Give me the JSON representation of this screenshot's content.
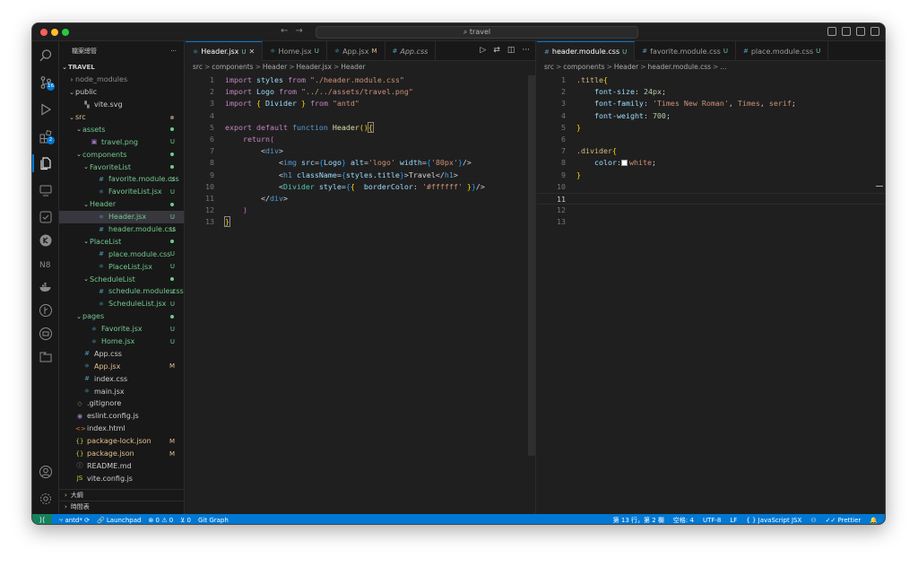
{
  "titlebar": {
    "search_text": "travel"
  },
  "activitybar": {
    "scm_badge": "16",
    "extensions_badge": "2"
  },
  "sidebar": {
    "title": "檔案總管",
    "more": "···",
    "root": "TRAVEL",
    "items": [
      {
        "label": "node_modules",
        "indent": 1,
        "chev": "›",
        "icon": "",
        "status": "",
        "cls": "name-dim"
      },
      {
        "label": "public",
        "indent": 1,
        "chev": "⌄",
        "icon": "",
        "status": "",
        "cls": ""
      },
      {
        "label": "vite.svg",
        "indent": 2,
        "chev": "",
        "icon": "▚",
        "status": "",
        "cls": ""
      },
      {
        "label": "src",
        "indent": 1,
        "chev": "⌄",
        "icon": "",
        "status": "dot-m",
        "cls": "name-m"
      },
      {
        "label": "assets",
        "indent": 2,
        "chev": "⌄",
        "icon": "",
        "status": "dot",
        "cls": "name-u"
      },
      {
        "label": "travel.png",
        "indent": 3,
        "chev": "",
        "icon": "▣",
        "status": "U",
        "cls": "name-u"
      },
      {
        "label": "components",
        "indent": 2,
        "chev": "⌄",
        "icon": "",
        "status": "dot",
        "cls": "name-u"
      },
      {
        "label": "FavoriteList",
        "indent": 3,
        "chev": "⌄",
        "icon": "",
        "status": "dot",
        "cls": "name-u"
      },
      {
        "label": "favorite.module.css",
        "indent": 4,
        "chev": "",
        "icon": "#",
        "status": "U",
        "cls": "name-u"
      },
      {
        "label": "FavoriteList.jsx",
        "indent": 4,
        "chev": "",
        "icon": "⚛",
        "status": "U",
        "cls": "name-u"
      },
      {
        "label": "Header",
        "indent": 3,
        "chev": "⌄",
        "icon": "",
        "status": "dot",
        "cls": "name-u"
      },
      {
        "label": "Header.jsx",
        "indent": 4,
        "chev": "",
        "icon": "⚛",
        "status": "U",
        "cls": "name-u",
        "selected": true
      },
      {
        "label": "header.module.css",
        "indent": 4,
        "chev": "",
        "icon": "#",
        "status": "U",
        "cls": "name-u"
      },
      {
        "label": "PlaceList",
        "indent": 3,
        "chev": "⌄",
        "icon": "",
        "status": "dot",
        "cls": "name-u"
      },
      {
        "label": "place.module.css",
        "indent": 4,
        "chev": "",
        "icon": "#",
        "status": "U",
        "cls": "name-u"
      },
      {
        "label": "PlaceList.jsx",
        "indent": 4,
        "chev": "",
        "icon": "⚛",
        "status": "U",
        "cls": "name-u"
      },
      {
        "label": "ScheduleList",
        "indent": 3,
        "chev": "⌄",
        "icon": "",
        "status": "dot",
        "cls": "name-u"
      },
      {
        "label": "schedule.module.css",
        "indent": 4,
        "chev": "",
        "icon": "#",
        "status": "U",
        "cls": "name-u"
      },
      {
        "label": "ScheduleList.jsx",
        "indent": 4,
        "chev": "",
        "icon": "⚛",
        "status": "U",
        "cls": "name-u"
      },
      {
        "label": "pages",
        "indent": 2,
        "chev": "⌄",
        "icon": "",
        "status": "dot",
        "cls": "name-u"
      },
      {
        "label": "Favorite.jsx",
        "indent": 3,
        "chev": "",
        "icon": "⚛",
        "status": "U",
        "cls": "name-u"
      },
      {
        "label": "Home.jsx",
        "indent": 3,
        "chev": "",
        "icon": "⚛",
        "status": "U",
        "cls": "name-u"
      },
      {
        "label": "App.css",
        "indent": 2,
        "chev": "",
        "icon": "#",
        "status": "",
        "cls": ""
      },
      {
        "label": "App.jsx",
        "indent": 2,
        "chev": "",
        "icon": "⚛",
        "status": "M",
        "cls": "name-m"
      },
      {
        "label": "index.css",
        "indent": 2,
        "chev": "",
        "icon": "#",
        "status": "",
        "cls": ""
      },
      {
        "label": "main.jsx",
        "indent": 2,
        "chev": "",
        "icon": "⚛",
        "status": "",
        "cls": ""
      },
      {
        "label": ".gitignore",
        "indent": 1,
        "chev": "",
        "icon": "◇",
        "status": "",
        "cls": ""
      },
      {
        "label": "eslint.config.js",
        "indent": 1,
        "chev": "",
        "icon": "◉",
        "status": "",
        "cls": ""
      },
      {
        "label": "index.html",
        "indent": 1,
        "chev": "",
        "icon": "<>",
        "status": "",
        "cls": ""
      },
      {
        "label": "package-lock.json",
        "indent": 1,
        "chev": "",
        "icon": "{}",
        "status": "M",
        "cls": "name-m"
      },
      {
        "label": "package.json",
        "indent": 1,
        "chev": "",
        "icon": "{}",
        "status": "M",
        "cls": "name-m"
      },
      {
        "label": "README.md",
        "indent": 1,
        "chev": "",
        "icon": "ⓘ",
        "status": "",
        "cls": ""
      },
      {
        "label": "vite.config.js",
        "indent": 1,
        "chev": "",
        "icon": "JS",
        "status": "",
        "cls": ""
      }
    ],
    "outline": "大綱",
    "timeline": "時間表"
  },
  "left_editor": {
    "tabs": [
      {
        "icon": "⚛",
        "label": "Header.jsx",
        "status": "U",
        "active": true,
        "close": "✕"
      },
      {
        "icon": "⚛",
        "label": "Home.jsx",
        "status": "U",
        "active": false
      },
      {
        "icon": "⚛",
        "label": "App.jsx",
        "status": "M",
        "active": false
      },
      {
        "icon": "#",
        "label": "App.css",
        "status": "",
        "active": false,
        "italic": true
      }
    ],
    "breadcrumb": [
      "src",
      "components",
      "Header",
      "Header.jsx",
      "Header"
    ],
    "lines": [
      "<span class='kw'>import</span> <span class='var'>styles</span> <span class='kw'>from</span> <span class='str'>\"./header.module.css\"</span>",
      "<span class='kw'>import</span> <span class='var'>Logo</span> <span class='kw'>from</span> <span class='str'>\"../../assets/travel.png\"</span>",
      "<span class='kw'>import</span> <span class='br1'>{</span> <span class='var'>Divider</span> <span class='br1'>}</span> <span class='kw'>from</span> <span class='str'>\"antd\"</span>",
      "",
      "<span class='kw'>export</span> <span class='kw'>default</span> <span class='kw2'>function</span> <span class='fn'>Header</span><span class='br1'>()</span><span class='br1 cursor-box'>{</span>",
      "    <span class='kw'>return</span><span class='br2'>(</span>",
      "        <span class='pun'>&lt;</span><span class='tag'>div</span><span class='pun'>&gt;</span>",
      "            <span class='pun'>&lt;</span><span class='tag'>img</span> <span class='attr'>src</span><span class='pun'>=</span><span class='br3'>{</span><span class='var'>Logo</span><span class='br3'>}</span> <span class='attr'>alt</span><span class='pun'>=</span><span class='str'>'logo'</span> <span class='attr'>width</span><span class='pun'>=</span><span class='br3'>{</span><span class='str'>'80px'</span><span class='br3'>}</span><span class='pun'>/&gt;</span>",
      "            <span class='pun'>&lt;</span><span class='tag'>h1</span> <span class='attr'>className</span><span class='pun'>=</span><span class='br3'>{</span><span class='var'>styles</span><span class='pun'>.</span><span class='var'>title</span><span class='br3'>}</span><span class='pun'>&gt;</span><span class='pun'>Travel</span><span class='pun'>&lt;/</span><span class='tag'>h1</span><span class='pun'>&gt;</span>",
      "            <span class='pun'>&lt;</span><span class='cls'>Divider</span> <span class='attr'>style</span><span class='pun'>=</span><span class='br3'>{</span><span class='br1'>{</span>  <span class='prop'>borderColor</span><span class='pun'>:</span> <span class='str'>'#ffffff'</span> <span class='br1'>}</span><span class='br3'>}</span><span class='pun'>/&gt;</span>",
      "        <span class='pun'>&lt;/</span><span class='tag'>div</span><span class='pun'>&gt;</span>",
      "    <span class='br2'>)</span>",
      "<span class='br1 cursor-box'>}</span>"
    ],
    "line_numbers": [
      "1",
      "2",
      "3",
      "4",
      "5",
      "6",
      "7",
      "8",
      "9",
      "10",
      "11",
      "12",
      "13"
    ]
  },
  "right_editor": {
    "tabs": [
      {
        "icon": "#",
        "label": "header.module.css",
        "status": "U",
        "active": true
      },
      {
        "icon": "#",
        "label": "favorite.module.css",
        "status": "U",
        "active": false
      },
      {
        "icon": "#",
        "label": "place.module.css",
        "status": "U",
        "active": false
      }
    ],
    "breadcrumb": [
      "src",
      "components",
      "Header",
      "header.module.css",
      "..."
    ],
    "lines": [
      "<span class='sel'>.title</span><span class='br1'>{</span>",
      "    <span class='prop'>font-size</span><span class='pun'>:</span> <span class='num'>24px</span><span class='pun'>;</span>",
      "    <span class='prop'>font-family</span><span class='pun'>:</span> <span class='str'>'Times New Roman'</span><span class='pun'>,</span> <span class='str'>Times</span><span class='pun'>,</span> <span class='str'>serif</span><span class='pun'>;</span>",
      "    <span class='prop'>font-weight</span><span class='pun'>:</span> <span class='num'>700</span><span class='pun'>;</span>",
      "<span class='br1'>}</span>",
      "",
      "<span class='sel'>.divider</span><span class='br1'>{</span>",
      "    <span class='prop'>color</span><span class='pun'>:</span><span class='swatch'></span><span class='str'>white</span><span class='pun'>;</span>",
      "<span class='br1'>}</span>",
      "",
      "",
      "",
      ""
    ],
    "line_numbers": [
      "1",
      "2",
      "3",
      "4",
      "5",
      "6",
      "7",
      "8",
      "9",
      "10",
      "11",
      "12",
      "13"
    ]
  },
  "statusbar": {
    "branch": "antd*",
    "launchpad": "Launchpad",
    "problems": "⊗ 0 ⚠ 0",
    "ports": "0",
    "gitgraph": "Git Graph",
    "position": "第 13 行，第 2 欄",
    "spaces": "空格: 4",
    "encoding": "UTF-8",
    "eol": "LF",
    "language": "JavaScript JSX",
    "formatter": "Prettier"
  }
}
